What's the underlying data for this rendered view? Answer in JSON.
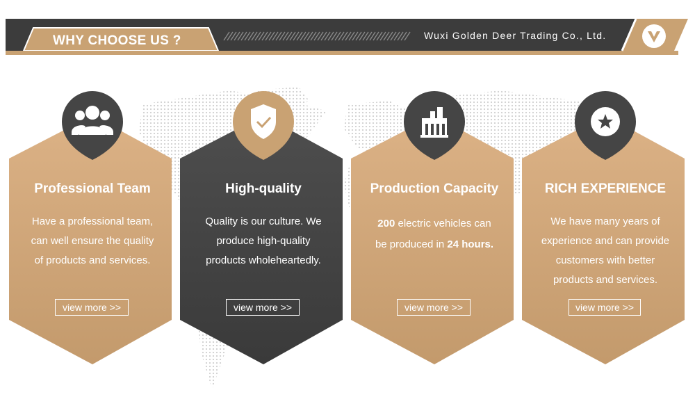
{
  "header": {
    "title": "WHY CHOOSE US ?",
    "company": "Wuxi Golden Deer Trading Co., Ltd.",
    "logo_icon": "v-logo-icon"
  },
  "colors": {
    "gold": "#c9a273",
    "dark": "#454545",
    "banner_dark": "#3c3c3c"
  },
  "cards": [
    {
      "icon": "users-icon",
      "title": "Professional Team",
      "lines": [
        "Have a professional team,",
        "can well ensure the quality",
        "of products and services."
      ],
      "button": "view more >>"
    },
    {
      "icon": "shield-check-icon",
      "title": "High-quality",
      "lines": [
        "Quality is our culture. We",
        "produce high-quality",
        "products wholeheartedly."
      ],
      "button": "view more >>"
    },
    {
      "icon": "factory-icon",
      "title": "Production Capacity",
      "line1_strong": "200",
      "line1_rest": " electric vehicles can",
      "line2_rest": "be produced in ",
      "line2_strong": "24 hours.",
      "button": "view more >>"
    },
    {
      "icon": "star-icon",
      "title": "RICH EXPERIENCE",
      "lines": [
        "We have many years of",
        "experience and can provide",
        "customers with better",
        "products and services."
      ],
      "button": "view more >>"
    }
  ]
}
